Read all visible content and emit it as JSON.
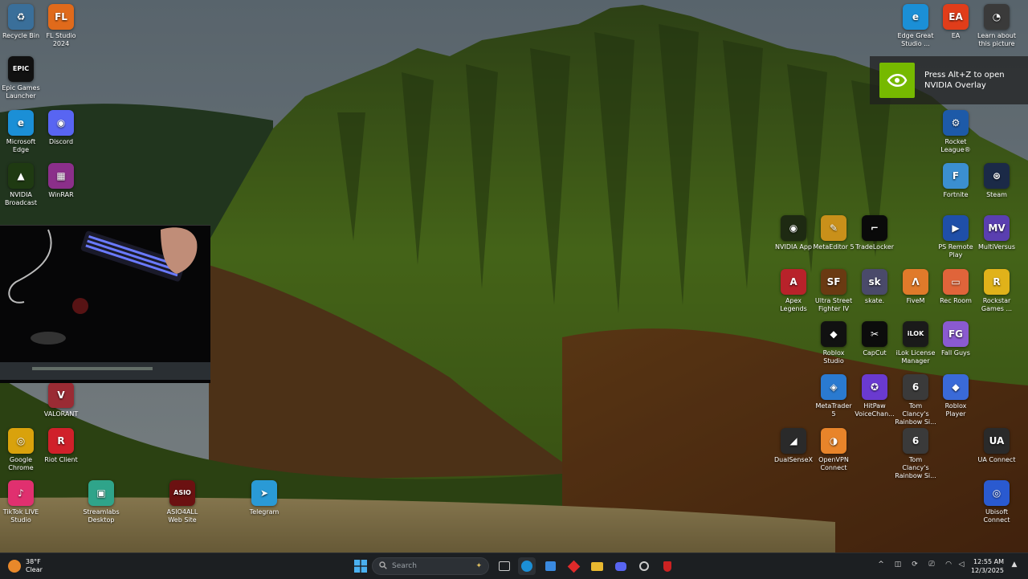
{
  "desktop": {
    "icons": [
      {
        "name": "recycle-bin",
        "label": "Recycle Bin",
        "glyph": "♻",
        "color": "#3a6f9a"
      },
      {
        "name": "fl-studio",
        "label": "FL Studio 2024",
        "glyph": "FL",
        "color": "#e06a1b"
      },
      {
        "name": "epic-games",
        "label": "Epic Games Launcher",
        "glyph": "EPIC",
        "color": "#111111"
      },
      {
        "name": "edge",
        "label": "Microsoft Edge",
        "glyph": "e",
        "color": "#1b8fd6"
      },
      {
        "name": "discord",
        "label": "Discord",
        "glyph": "◉",
        "color": "#5865f2"
      },
      {
        "name": "nvidia-broadcast",
        "label": "NVIDIA Broadcast",
        "glyph": "▲",
        "color": "#1f3a12"
      },
      {
        "name": "winrar",
        "label": "WinRAR",
        "glyph": "▦",
        "color": "#8b2f8a"
      },
      {
        "name": "valorant",
        "label": "VALORANT",
        "glyph": "V",
        "color": "#9a2b34"
      },
      {
        "name": "chrome",
        "label": "Google Chrome",
        "glyph": "◎",
        "color": "#d9a20c"
      },
      {
        "name": "riot-client",
        "label": "Riot Client",
        "glyph": "R",
        "color": "#d0202a"
      },
      {
        "name": "tiktok-live",
        "label": "TikTok LIVE Studio",
        "glyph": "♪",
        "color": "#e0306f"
      },
      {
        "name": "streamlabs",
        "label": "Streamlabs Desktop",
        "glyph": "▣",
        "color": "#2fa48a"
      },
      {
        "name": "asio4all",
        "label": "ASIO4ALL Web Site",
        "glyph": "ASIO",
        "color": "#6b1111"
      },
      {
        "name": "telegram",
        "label": "Telegram",
        "glyph": "➤",
        "color": "#2a9ad6"
      },
      {
        "name": "edge-studio",
        "label": "Edge Great Studio ...",
        "glyph": "e",
        "color": "#1b8fd6"
      },
      {
        "name": "ea",
        "label": "EA",
        "glyph": "EA",
        "color": "#e03d1a"
      },
      {
        "name": "learn-picture",
        "label": "Learn about this picture",
        "glyph": "◔",
        "color": "#3a3a3a"
      },
      {
        "name": "rocket-league",
        "label": "Rocket League®",
        "glyph": "⚙",
        "color": "#1d5aa8"
      },
      {
        "name": "fortnite",
        "label": "Fortnite",
        "glyph": "F",
        "color": "#3b8fd0"
      },
      {
        "name": "steam",
        "label": "Steam",
        "glyph": "⊛",
        "color": "#1b2a47"
      },
      {
        "name": "nvidia-app",
        "label": "NVIDIA App",
        "glyph": "◉",
        "color": "#1e2a12"
      },
      {
        "name": "metaeditor",
        "label": "MetaEditor 5",
        "glyph": "✎",
        "color": "#c9901a"
      },
      {
        "name": "tradelocker",
        "label": "TradeLocker",
        "glyph": "⌐",
        "color": "#0a0a0a"
      },
      {
        "name": "ps-remote-play",
        "label": "PS Remote Play",
        "glyph": "▶",
        "color": "#1f4fa8"
      },
      {
        "name": "multiversus",
        "label": "MultiVersus",
        "glyph": "MV",
        "color": "#5a3fb0"
      },
      {
        "name": "apex",
        "label": "Apex Legends",
        "glyph": "A",
        "color": "#b8222a"
      },
      {
        "name": "sf4",
        "label": "Ultra Street Fighter IV",
        "glyph": "SF",
        "color": "#6a3a12"
      },
      {
        "name": "skate",
        "label": "skate.",
        "glyph": "sk",
        "color": "#4a4a6a"
      },
      {
        "name": "fivem",
        "label": "FiveM",
        "glyph": "Λ",
        "color": "#e07a2a"
      },
      {
        "name": "rec-room",
        "label": "Rec Room",
        "glyph": "▭",
        "color": "#e0643a"
      },
      {
        "name": "rockstar",
        "label": "Rockstar Games ...",
        "glyph": "R",
        "color": "#e0b21a"
      },
      {
        "name": "roblox-studio",
        "label": "Roblox Studio",
        "glyph": "◆",
        "color": "#111111"
      },
      {
        "name": "capcut",
        "label": "CapCut",
        "glyph": "✂",
        "color": "#0c0c0c"
      },
      {
        "name": "ilok",
        "label": "iLok License Manager",
        "glyph": "iLOK",
        "color": "#1a1a1a"
      },
      {
        "name": "fall-guys",
        "label": "Fall Guys",
        "glyph": "FG",
        "color": "#8a5ad0"
      },
      {
        "name": "metatrader",
        "label": "MetaTrader 5",
        "glyph": "◈",
        "color": "#2a7ad0"
      },
      {
        "name": "hitpaw",
        "label": "HitPaw VoiceChan...",
        "glyph": "✪",
        "color": "#6a3ad0"
      },
      {
        "name": "rainbow-six-1",
        "label": "Tom Clancy's Rainbow Si...",
        "glyph": "6",
        "color": "#3a3a3a"
      },
      {
        "name": "roblox-player",
        "label": "Roblox Player",
        "glyph": "◆",
        "color": "#3a6ad8"
      },
      {
        "name": "dualsensex",
        "label": "DualSenseX",
        "glyph": "◢",
        "color": "#2a2a2a"
      },
      {
        "name": "openvpn",
        "label": "OpenVPN Connect",
        "glyph": "◑",
        "color": "#e8842a"
      },
      {
        "name": "rainbow-six-2",
        "label": "Tom Clancy's Rainbow Si...",
        "glyph": "6",
        "color": "#3a3a3a"
      },
      {
        "name": "ua-connect",
        "label": "UA Connect",
        "glyph": "UA",
        "color": "#2a2a2a"
      },
      {
        "name": "ubisoft-connect",
        "label": "Ubisoft Connect",
        "glyph": "◎",
        "color": "#2a5ad0"
      }
    ]
  },
  "toast": {
    "message": "Press Alt+Z to open NVIDIA Overlay"
  },
  "taskbar": {
    "weather": {
      "temp": "38°F",
      "condition": "Clear"
    },
    "search": {
      "placeholder": "Search"
    },
    "clock": {
      "time": "12:55 AM",
      "date": "12/3/2025"
    }
  }
}
